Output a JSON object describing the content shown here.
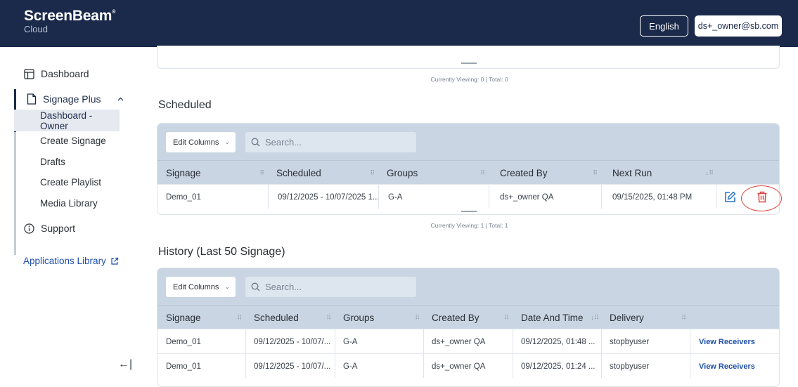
{
  "header": {
    "brand": "ScreenBeam",
    "brand_mark": "®",
    "brand_sub": "Cloud",
    "language_button": "English",
    "user_button": "ds+_owner@sb.com"
  },
  "sidebar": {
    "dashboard": "Dashboard",
    "signage_plus": "Signage Plus",
    "sub_items": [
      "Dashboard - Owner",
      "Create Signage",
      "Drafts",
      "Create Playlist",
      "Media Library"
    ],
    "support": "Support",
    "apps_library": "Applications Library",
    "collapse_glyph": "←|"
  },
  "top_caption": "Currently Viewing: 0  |  Total: 0",
  "scheduled": {
    "title": "Scheduled",
    "edit_columns": "Edit Columns",
    "search_placeholder": "Search...",
    "columns": [
      "Signage",
      "Scheduled",
      "Groups",
      "Created By",
      "Next Run"
    ],
    "sort_indicator": "↓",
    "rows": [
      {
        "signage": "Demo_01",
        "scheduled": "09/12/2025 - 10/07/2025 1...",
        "groups": "G-A",
        "created_by": "ds+_owner QA",
        "next_run": "09/15/2025, 01:48 PM"
      }
    ],
    "caption": "Currently Viewing: 1  |  Total: 1"
  },
  "history": {
    "title": "History (Last 50 Signage)",
    "edit_columns": "Edit Columns",
    "search_placeholder": "Search...",
    "columns": [
      "Signage",
      "Scheduled",
      "Groups",
      "Created By",
      "Date And Time",
      "Delivery"
    ],
    "sort_indicator": "↓",
    "rows": [
      {
        "signage": "Demo_01",
        "scheduled": "09/12/2025 - 10/07/...",
        "groups": "G-A",
        "created_by": "ds+_owner QA",
        "date_time": "09/12/2025, 01:48 ...",
        "delivery": "stopbyuser",
        "action": "View Receivers"
      },
      {
        "signage": "Demo_01",
        "scheduled": "09/12/2025 - 10/07/...",
        "groups": "G-A",
        "created_by": "ds+_owner QA",
        "date_time": "09/12/2025, 01:24 ...",
        "delivery": "stopbyuser",
        "action": "View Receivers"
      }
    ]
  },
  "colors": {
    "topbar": "#1b2a4a",
    "table_header": "#c9d5e2",
    "edit_icon": "#2a74c9",
    "delete_icon": "#d9463e",
    "link": "#1e4fa8"
  },
  "icons": {
    "dashboard": "layout-icon",
    "signage": "document-icon",
    "support": "info-icon",
    "external": "external-link-icon",
    "search": "search-icon",
    "edit": "edit-icon",
    "delete": "trash-icon"
  }
}
